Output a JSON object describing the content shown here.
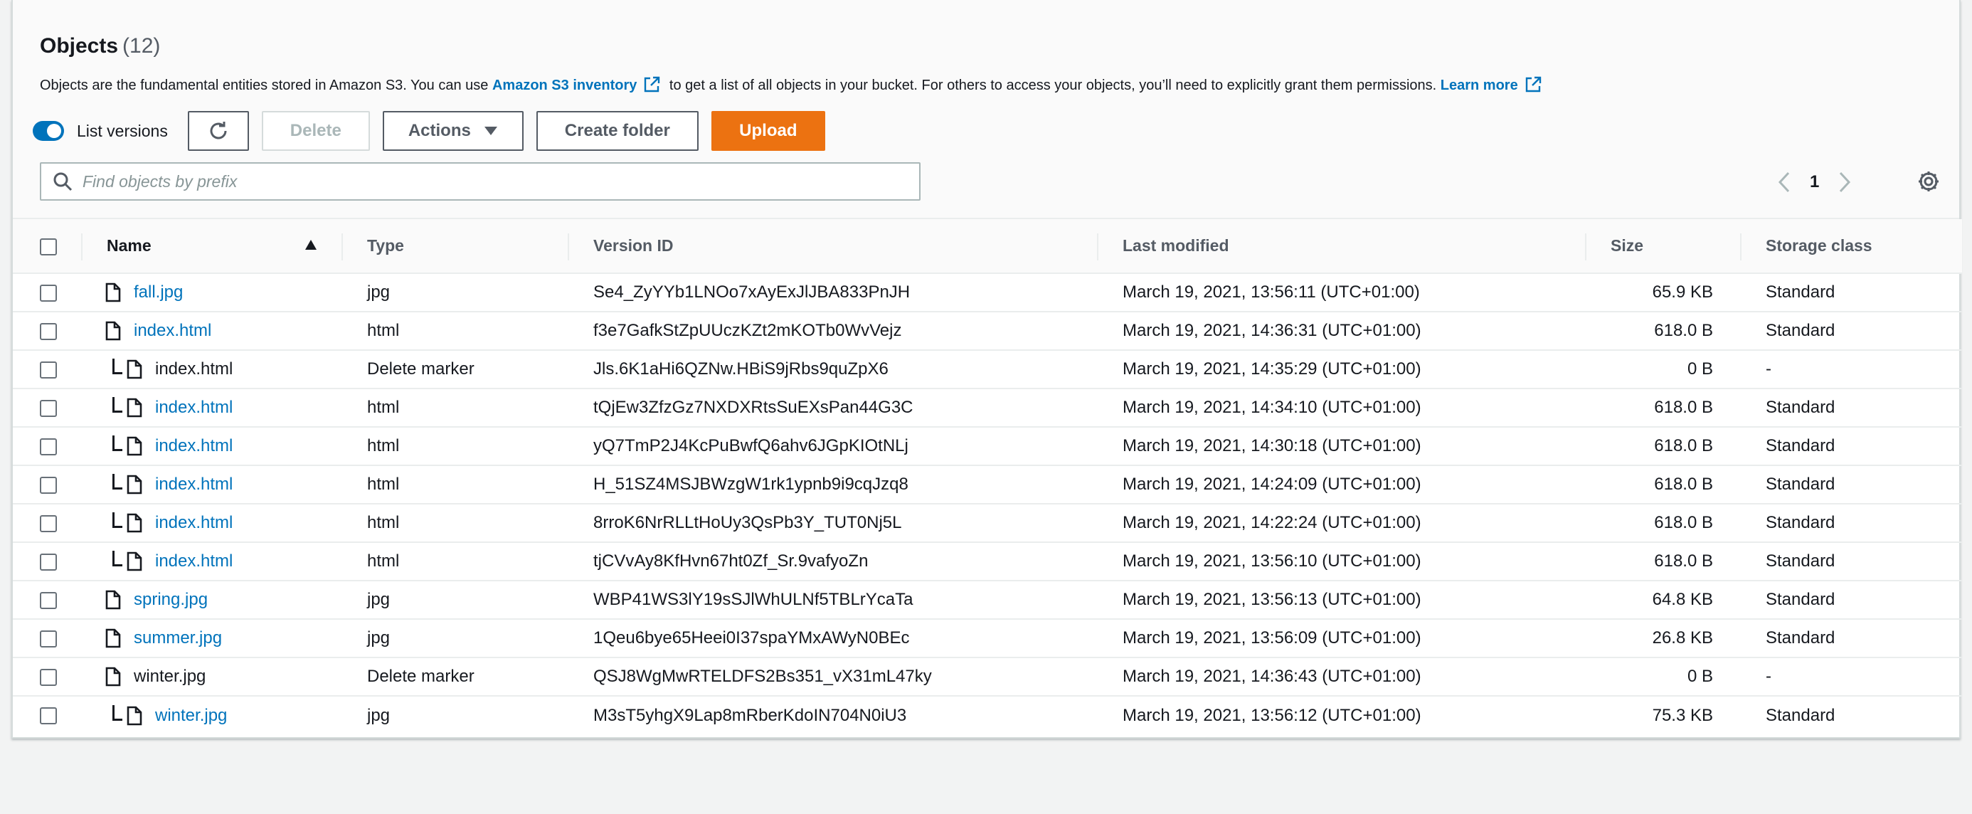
{
  "header": {
    "title": "Objects",
    "count": "(12)",
    "desc_1": "Objects are the fundamental entities stored in Amazon S3. You can use ",
    "desc_link_1": "Amazon S3 inventory",
    "desc_2": " to get a list of all objects in your bucket. For others to access your objects, you’ll need to explicitly grant them permissions. ",
    "desc_link_2": "Learn more"
  },
  "toolbar": {
    "toggle_label": "List versions",
    "toggle_on": true,
    "delete_label": "Delete",
    "actions_label": "Actions",
    "create_folder_label": "Create folder",
    "upload_label": "Upload"
  },
  "search": {
    "placeholder": "Find objects by prefix"
  },
  "pagination": {
    "current_page": "1"
  },
  "table": {
    "columns": {
      "name": "Name",
      "type": "Type",
      "version_id": "Version ID",
      "last_modified": "Last modified",
      "size": "Size",
      "storage_class": "Storage class"
    },
    "rows": [
      {
        "name": "fall.jpg",
        "type": "jpg",
        "version_id": "Se4_ZyYYb1LNOo7xAyExJlJBA833PnJH",
        "last_modified": "March 19, 2021, 13:56:11 (UTC+01:00)",
        "size": "65.9 KB",
        "storage_class": "Standard"
      },
      {
        "name": "index.html",
        "type": "html",
        "version_id": "f3e7GafkStZpUUczKZt2mKOTb0WvVejz",
        "last_modified": "March 19, 2021, 14:36:31 (UTC+01:00)",
        "size": "618.0 B",
        "storage_class": "Standard"
      },
      {
        "name": "index.html",
        "type": "Delete marker",
        "version_id": "Jls.6K1aHi6QZNw.HBiS9jRbs9quZpX6",
        "last_modified": "March 19, 2021, 14:35:29 (UTC+01:00)",
        "size": "0 B",
        "storage_class": "-"
      },
      {
        "name": "index.html",
        "type": "html",
        "version_id": "tQjEw3ZfzGz7NXDXRtsSuEXsPan44G3C",
        "last_modified": "March 19, 2021, 14:34:10 (UTC+01:00)",
        "size": "618.0 B",
        "storage_class": "Standard"
      },
      {
        "name": "index.html",
        "type": "html",
        "version_id": "yQ7TmP2J4KcPuBwfQ6ahv6JGpKIOtNLj",
        "last_modified": "March 19, 2021, 14:30:18 (UTC+01:00)",
        "size": "618.0 B",
        "storage_class": "Standard"
      },
      {
        "name": "index.html",
        "type": "html",
        "version_id": "H_51SZ4MSJBWzgW1rk1ypnb9i9cqJzq8",
        "last_modified": "March 19, 2021, 14:24:09 (UTC+01:00)",
        "size": "618.0 B",
        "storage_class": "Standard"
      },
      {
        "name": "index.html",
        "type": "html",
        "version_id": "8rroK6NrRLLtHoUy3QsPb3Y_TUT0Nj5L",
        "last_modified": "March 19, 2021, 14:22:24 (UTC+01:00)",
        "size": "618.0 B",
        "storage_class": "Standard"
      },
      {
        "name": "index.html",
        "type": "html",
        "version_id": "tjCVvAy8KfHvn67ht0Zf_Sr.9vafyoZn",
        "last_modified": "March 19, 2021, 13:56:10 (UTC+01:00)",
        "size": "618.0 B",
        "storage_class": "Standard"
      },
      {
        "name": "spring.jpg",
        "type": "jpg",
        "version_id": "WBP41WS3lY19sSJlWhULNf5TBLrYcaTa",
        "last_modified": "March 19, 2021, 13:56:13 (UTC+01:00)",
        "size": "64.8 KB",
        "storage_class": "Standard"
      },
      {
        "name": "summer.jpg",
        "type": "jpg",
        "version_id": "1Qeu6bye65Heei0I37spaYMxAWyN0BEc",
        "last_modified": "March 19, 2021, 13:56:09 (UTC+01:00)",
        "size": "26.8 KB",
        "storage_class": "Standard"
      },
      {
        "name": "winter.jpg",
        "type": "Delete marker",
        "version_id": "QSJ8WgMwRTELDFS2Bs351_vX31mL47ky",
        "last_modified": "March 19, 2021, 14:36:43 (UTC+01:00)",
        "size": "0 B",
        "storage_class": "-"
      },
      {
        "name": "winter.jpg",
        "type": "jpg",
        "version_id": "M3sT5yhgX9Lap8mRberKdoIN704N0iU3",
        "last_modified": "March 19, 2021, 13:56:12 (UTC+01:00)",
        "size": "75.3 KB",
        "storage_class": "Standard"
      }
    ]
  },
  "colors": {
    "link": "#0073bb",
    "primary_button": "#ec7211",
    "toggle_on": "#0073bb",
    "page_bg": "#f2f3f3"
  }
}
